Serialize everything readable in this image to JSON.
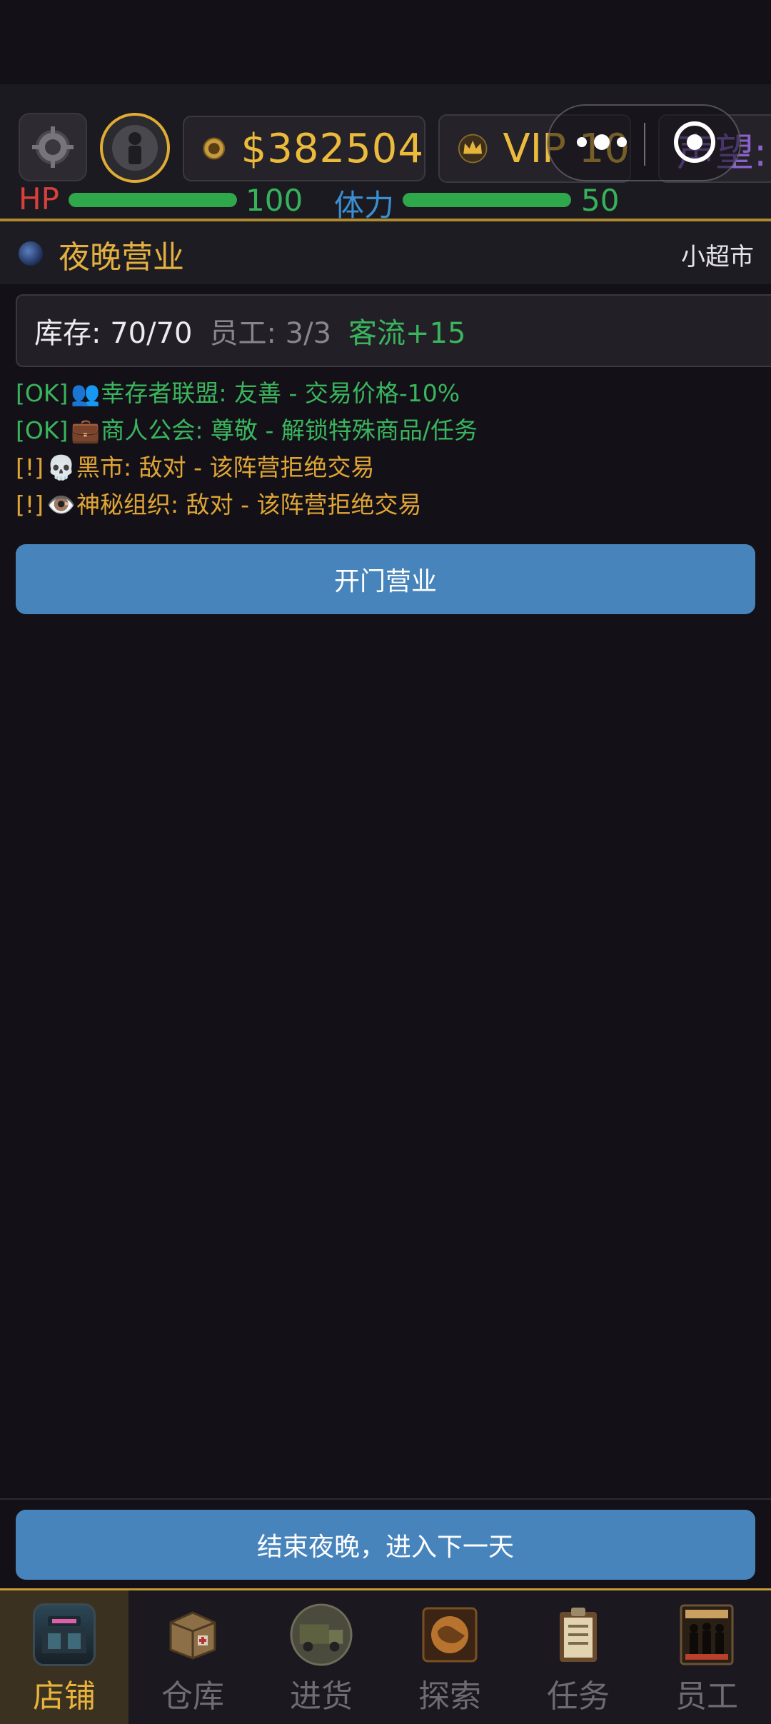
{
  "hud": {
    "money": "$382504",
    "vip": "VIP 10",
    "reputation": "声望:",
    "hp_label": "HP",
    "hp_value": "100",
    "hp_fraction": 1.0,
    "stamina_label": "体力",
    "stamina_value": "50",
    "stamina_fraction": 1.0
  },
  "section": {
    "title": "夜晚营业",
    "shop_name": "小超市"
  },
  "stats": {
    "stock": "库存: 70/70",
    "staff": "员工: 3/3",
    "flow": "客流+15"
  },
  "factions": [
    {
      "status": "[OK]",
      "icon": "👥",
      "text": "幸存者联盟: 友善 - 交易价格-10%"
    },
    {
      "status": "[OK]",
      "icon": "💼",
      "text": "商人公会: 尊敬 - 解锁特殊商品/任务"
    },
    {
      "status": "[!]",
      "icon": "💀",
      "text": "黑市: 敌对 - 该阵营拒绝交易"
    },
    {
      "status": "[!]",
      "icon": "👁️",
      "text": "神秘组织: 敌对 - 该阵营拒绝交易"
    }
  ],
  "buttons": {
    "open": "开门营业",
    "end_night": "结束夜晚，进入下一天"
  },
  "tabs": [
    {
      "label": "店铺",
      "active": true
    },
    {
      "label": "仓库"
    },
    {
      "label": "进货"
    },
    {
      "label": "探索"
    },
    {
      "label": "任务"
    },
    {
      "label": "员工"
    }
  ],
  "colors": {
    "accent_gold": "#ecbb3c",
    "button_blue": "#4884bc",
    "ok_green": "#3ab55d",
    "warn_orange": "#e0a535",
    "hp_red": "#d9403a",
    "stamina_blue": "#3a8fd1",
    "reputation_purple": "#8a62c9"
  }
}
